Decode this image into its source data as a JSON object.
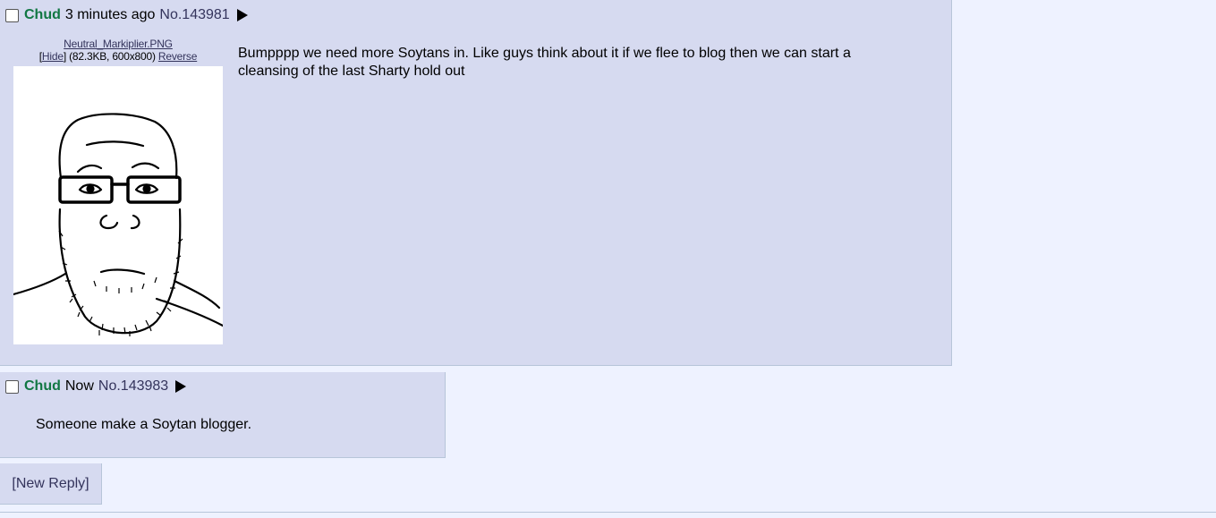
{
  "posts": [
    {
      "name": "Chud",
      "time": "3 minutes ago",
      "number": "No.143981",
      "file": {
        "filename": "Neutral_Markiplier.PNG",
        "hide_label": "Hide",
        "meta": "(82.3KB, 600x800)",
        "reverse_label": "Reverse"
      },
      "message": "Bumpppp we need more Soytans in. Like guys think about it if we flee to blog then we can start a cleansing of the last Sharty hold out"
    },
    {
      "name": "Chud",
      "time": "Now",
      "number": "No.143983",
      "message": "Someone make a Soytan blogger."
    }
  ],
  "new_reply_label": "[New Reply]",
  "colors": {
    "page_bg": "#eef2ff",
    "post_bg": "#d6daf0",
    "post_border": "#b7c5d9",
    "name": "#117743",
    "link": "#34345c"
  },
  "icons": {
    "select": "checkbox-icon",
    "menu": "play-triangle-icon"
  }
}
